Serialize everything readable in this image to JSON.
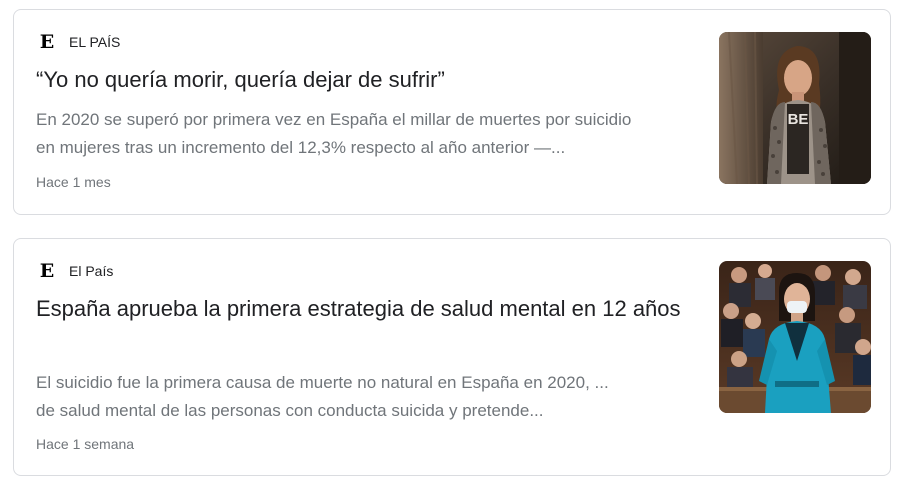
{
  "results": [
    {
      "source": "EL PAÍS",
      "logo_letter": "E",
      "headline": "“Yo no quería morir, quería dejar de sufrir”",
      "snippet_lines": [
        "En 2020 se superó por primera vez en España el millar de muertes por suicidio",
        "en mujeres tras un incremento del 12,3% respecto al año anterior —..."
      ],
      "time": "Hace 1 mes",
      "thumbnail_shirt_text": "BE"
    },
    {
      "source": "El País",
      "logo_letter": "E",
      "headline": "España aprueba la primera estrategia de salud mental en 12 años",
      "snippet_lines": [
        "El suicidio fue la primera causa de muerte no natural en España en 2020, ...",
        "de salud mental de las personas con conducta suicida y pretende..."
      ],
      "time": "Hace 1 semana"
    }
  ]
}
